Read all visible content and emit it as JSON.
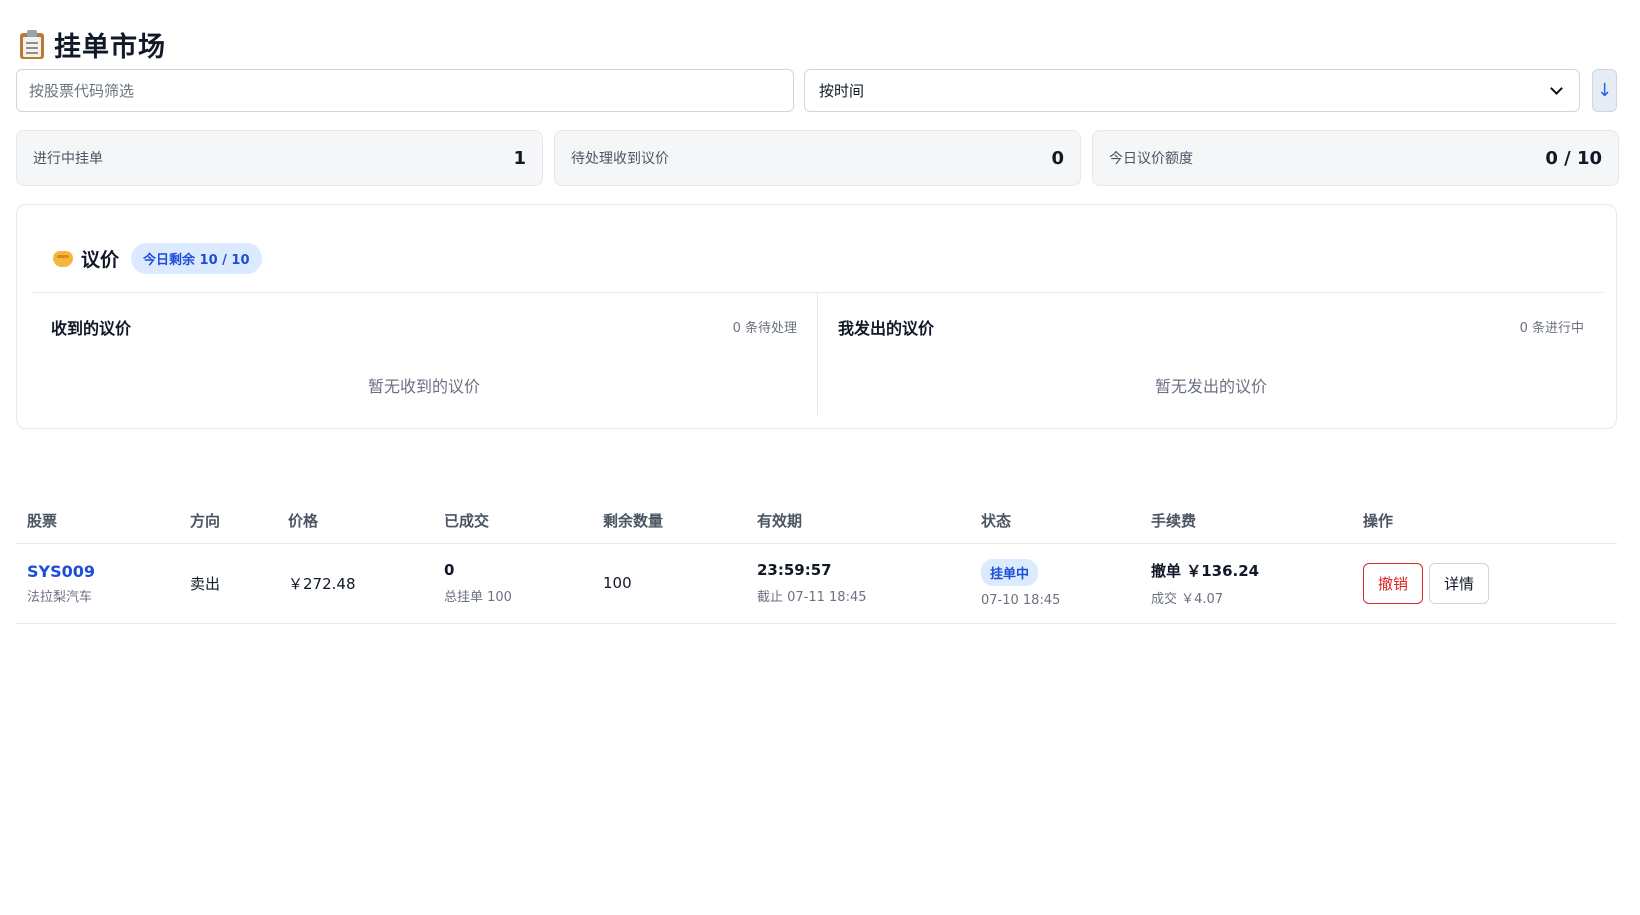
{
  "header": {
    "title": "挂单市场",
    "icon": "clipboard-icon"
  },
  "filters": {
    "stock_placeholder": "按股票代码筛选",
    "sort_value": "按时间",
    "sort_direction": "↓"
  },
  "stats": [
    {
      "label": "进行中挂单",
      "value": "1"
    },
    {
      "label": "待处理收到议价",
      "value": "0"
    },
    {
      "label": "今日议价额度",
      "value": "0 / 10"
    }
  ],
  "negotiation": {
    "title": "议价",
    "icon": "handshake-icon",
    "quota_badge": "今日剩余 10 / 10",
    "received": {
      "title": "收到的议价",
      "count": "0 条待处理",
      "empty": "暂无收到的议价"
    },
    "sent": {
      "title": "我发出的议价",
      "count": "0 条进行中",
      "empty": "暂无发出的议价"
    }
  },
  "table": {
    "headers": [
      "股票",
      "方向",
      "价格",
      "已成交",
      "剩余数量",
      "有效期",
      "状态",
      "手续费",
      "操作"
    ],
    "rows": [
      {
        "code": "SYS009",
        "name": "法拉梨汽车",
        "direction": "卖出",
        "price": "￥272.48",
        "filled": "0",
        "filled_sub": "总挂单 100",
        "remaining": "100",
        "expiry": "23:59:57",
        "expiry_sub": "截止 07-11 18:45",
        "status": "挂单中",
        "status_time": "07-10 18:45",
        "fee_cancel": "撤单 ￥136.24",
        "fee_deal": "成交 ￥4.07",
        "cancel_label": "撤销",
        "detail_label": "详情"
      }
    ]
  },
  "colors": {
    "accent": "#1d4ed8",
    "danger": "#dc2626",
    "badge_bg": "#dbeafe"
  }
}
